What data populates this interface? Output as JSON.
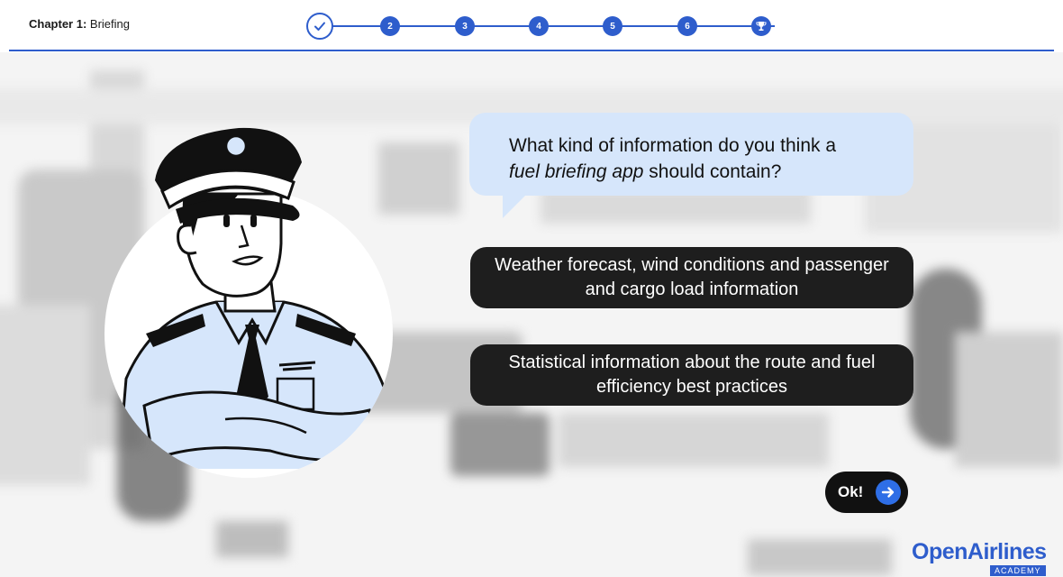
{
  "header": {
    "chapter_label": "Chapter 1:",
    "chapter_name": "Briefing",
    "steps": [
      {
        "label": "",
        "state": "completed",
        "icon": "check-icon"
      },
      {
        "label": "2",
        "state": "upcoming"
      },
      {
        "label": "3",
        "state": "upcoming"
      },
      {
        "label": "4",
        "state": "upcoming"
      },
      {
        "label": "5",
        "state": "upcoming"
      },
      {
        "label": "6",
        "state": "upcoming"
      },
      {
        "label": "",
        "state": "upcoming",
        "icon": "trophy-icon"
      }
    ]
  },
  "question": {
    "text_before": "What kind of information do you think a",
    "text_emphasis": "fuel briefing app",
    "text_after": "should contain?"
  },
  "answers": [
    {
      "label": "Weather forecast, wind conditions and passenger and cargo load information"
    },
    {
      "label": "Statistical information about the route and fuel efficiency best practices"
    }
  ],
  "ok_button": {
    "label": "Ok!",
    "icon": "arrow-right-icon"
  },
  "logo": {
    "main": "OpenAirlines",
    "sub": "ACADEMY"
  },
  "colors": {
    "accent": "#2e5dcc",
    "bubble": "#d6e6fb",
    "answer_bg": "#1e1e1e"
  }
}
